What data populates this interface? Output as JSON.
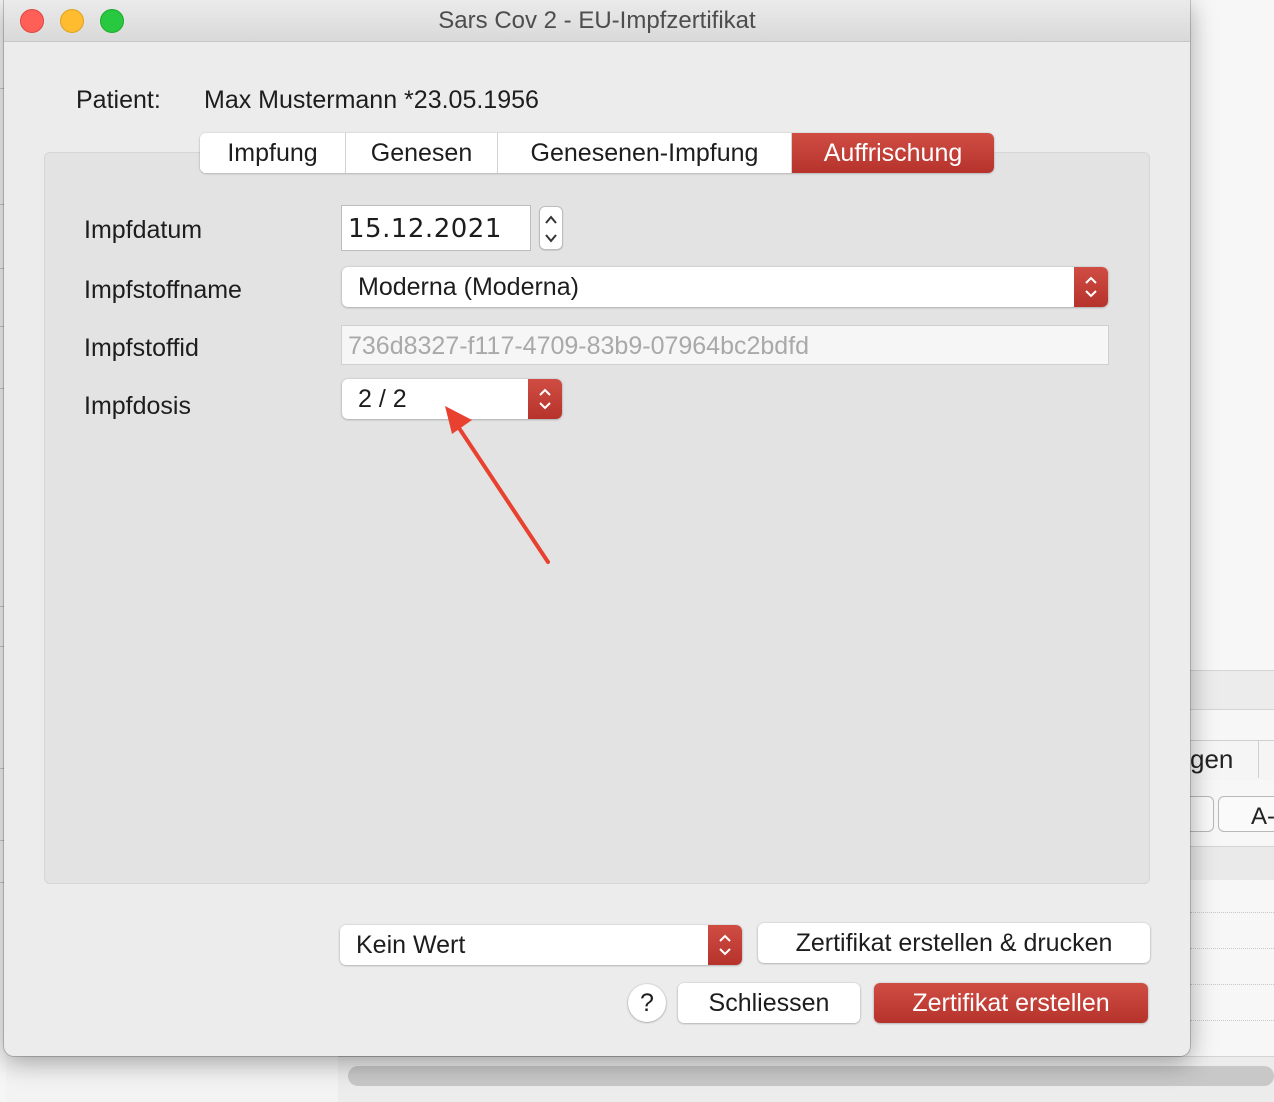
{
  "window": {
    "title": "Sars Cov 2 - EU-Impfzertifikat"
  },
  "patient": {
    "label": "Patient:",
    "value": "Max Mustermann *23.05.1956"
  },
  "tabs": [
    {
      "label": "Impfung",
      "active": false
    },
    {
      "label": "Genesen",
      "active": false
    },
    {
      "label": "Genesenen-Impfung",
      "active": false
    },
    {
      "label": "Auffrischung",
      "active": true
    }
  ],
  "form": {
    "impfdatum_label": "Impfdatum",
    "impfdatum_value": "15.12.2021",
    "impfstoffname_label": "Impfstoffname",
    "impfstoffname_value": "Moderna (Moderna)",
    "impfstoffid_label": "Impfstoffid",
    "impfstoffid_value": "736d8327-f117-4709-83b9-07964bc2bdfd",
    "impfdosis_label": "Impfdosis",
    "impfdosis_value": "2 / 2"
  },
  "footer": {
    "printer_select_value": "Kein Wert",
    "create_print_label": "Zertifikat erstellen & drucken",
    "help_label": "?",
    "close_label": "Schliessen",
    "create_label": "Zertifikat erstellen"
  },
  "background": {
    "tab_fragment": "gen",
    "button_fragment": "A-"
  },
  "colors": {
    "accent": "#c0392b",
    "annotation_arrow": "#e8412f",
    "close": "#fe5f57",
    "minimize": "#febc2e",
    "zoom": "#28c840"
  }
}
